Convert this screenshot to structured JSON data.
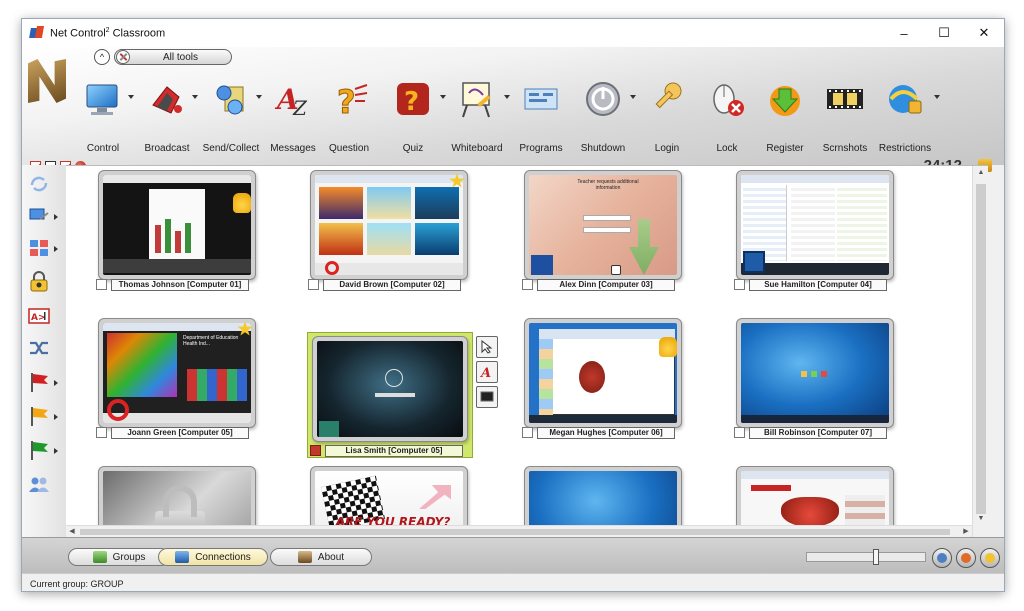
{
  "window": {
    "title": "Net Control",
    "title_sup": "2",
    "title_suffix": " Classroom",
    "minimize": "–",
    "maximize": "☐",
    "close": "✕"
  },
  "toolbar": {
    "all_tools_label": "All tools",
    "tools": [
      {
        "label": "Control",
        "icon": "monitor-icon",
        "has_dropdown": true
      },
      {
        "label": "Broadcast",
        "icon": "broadcast-icon",
        "has_dropdown": true
      },
      {
        "label": "Send/Collect",
        "icon": "send-collect-icon",
        "has_dropdown": true
      },
      {
        "label": "Messages",
        "icon": "messages-icon",
        "has_dropdown": false
      },
      {
        "label": "Question",
        "icon": "question-icon",
        "has_dropdown": false
      },
      {
        "label": "Quiz",
        "icon": "quiz-icon",
        "has_dropdown": true
      },
      {
        "label": "Whiteboard",
        "icon": "whiteboard-icon",
        "has_dropdown": true
      },
      {
        "label": "Programs",
        "icon": "programs-icon",
        "has_dropdown": false
      },
      {
        "label": "Shutdown",
        "icon": "shutdown-icon",
        "has_dropdown": true
      },
      {
        "label": "Login",
        "icon": "key-icon",
        "has_dropdown": false
      },
      {
        "label": "Lock",
        "icon": "lock-mouse-icon",
        "has_dropdown": false
      },
      {
        "label": "Register",
        "icon": "register-icon",
        "has_dropdown": false
      },
      {
        "label": "Scrnshots",
        "icon": "film-icon",
        "has_dropdown": false
      },
      {
        "label": "Restrictions",
        "icon": "restrictions-icon",
        "has_dropdown": true
      }
    ],
    "timer": "24:12"
  },
  "sidebar": {
    "items": [
      {
        "icon": "refresh-icon"
      },
      {
        "icon": "monitor-send-icon"
      },
      {
        "icon": "layout-grid-icon"
      },
      {
        "icon": "lock-user-icon"
      },
      {
        "icon": "text-input-icon",
        "text": "A>]"
      },
      {
        "icon": "shuffle-icon"
      },
      {
        "icon": "red-flag-icon"
      },
      {
        "icon": "yellow-flag-icon"
      },
      {
        "icon": "green-flag-icon"
      },
      {
        "icon": "users-icon"
      }
    ]
  },
  "computers": [
    {
      "name": "Thomas Johnson [Computer 01]",
      "badge": "hand"
    },
    {
      "name": "David Brown [Computer 02]",
      "badge": "star"
    },
    {
      "name": "Alex Dinn [Computer 03]",
      "badge": ""
    },
    {
      "name": "Sue Hamilton [Computer 04]",
      "badge": ""
    },
    {
      "name": "Joann Green [Computer 05]",
      "badge": "star"
    },
    {
      "name": "Lisa Smith [Computer 05]",
      "badge": "",
      "selected": true
    },
    {
      "name": "Megan Hughes [Computer 06]",
      "badge": "hand"
    },
    {
      "name": "Bill Robinson [Computer 07]",
      "badge": ""
    },
    {
      "name": "",
      "badge": ""
    },
    {
      "name": "",
      "badge": ""
    },
    {
      "name": "",
      "badge": ""
    },
    {
      "name": "",
      "badge": ""
    }
  ],
  "screen_texts": {
    "alex_title": "Teacher requests additional information",
    "joann_title": "Department of Education Health Ind...",
    "ready": "ARE YOU READY?"
  },
  "tabs": [
    {
      "label": "Groups",
      "active": false
    },
    {
      "label": "Connections",
      "active": true
    },
    {
      "label": "About",
      "active": false
    }
  ],
  "status": {
    "text": "Current group: GROUP"
  },
  "colors": {
    "selected_bg": "#cfe86b",
    "accent": "#e8a000"
  }
}
